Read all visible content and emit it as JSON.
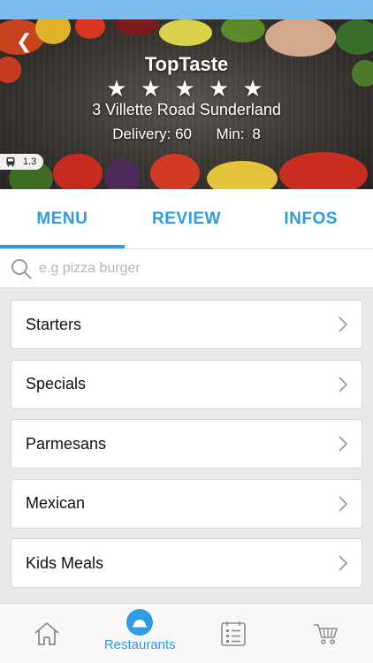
{
  "restaurant": {
    "name": "TopTaste",
    "rating": 5,
    "stars": "★ ★ ★ ★ ★",
    "address": "3 Villette Road Sunderland",
    "delivery_label": "Delivery:",
    "delivery_value": "60",
    "min_label": "Min:",
    "min_value": "8",
    "distance": "1.3"
  },
  "tabs": [
    {
      "label": "MENU",
      "active": true
    },
    {
      "label": "REVIEW",
      "active": false
    },
    {
      "label": "INFOS",
      "active": false
    }
  ],
  "search": {
    "placeholder": "e.g pizza burger",
    "value": ""
  },
  "menu": {
    "items": [
      {
        "label": "Starters"
      },
      {
        "label": "Specials"
      },
      {
        "label": "Parmesans"
      },
      {
        "label": "Mexican"
      },
      {
        "label": "Kids Meals"
      }
    ]
  },
  "bottom_nav": {
    "items": [
      {
        "icon": "home-icon",
        "label": ""
      },
      {
        "icon": "restaurants-icon",
        "label": "Restaurants",
        "active": true
      },
      {
        "icon": "list-icon",
        "label": ""
      },
      {
        "icon": "cart-icon",
        "label": ""
      }
    ]
  },
  "colors": {
    "accent": "#2f9be3",
    "status_bar": "#7bbcf0"
  }
}
